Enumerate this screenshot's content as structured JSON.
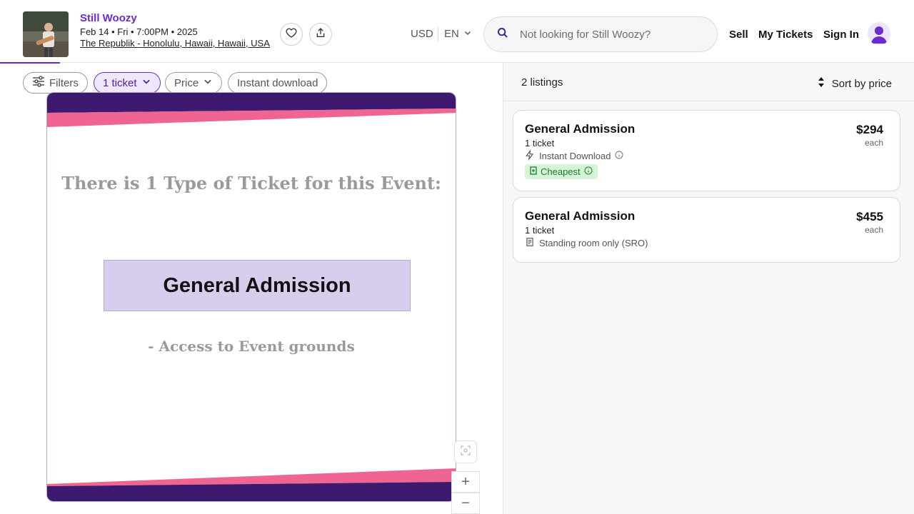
{
  "event": {
    "name": "Still Woozy",
    "date_line": "Feb 14 • Fri • 7:00PM • 2025",
    "venue": "The Republik - Honolulu, Hawaii, Hawaii, USA",
    "thumbnail_icon": "artist-photo"
  },
  "header": {
    "currency": "USD",
    "language": "EN",
    "search_placeholder": "Not looking for Still Woozy?",
    "nav": {
      "sell": "Sell",
      "my_tickets": "My Tickets",
      "sign_in": "Sign In"
    },
    "accent_color": "#6a2bd0"
  },
  "filters": {
    "filters_label": "Filters",
    "quantity_label": "1 ticket",
    "price_label": "Price",
    "instant_label": "Instant download"
  },
  "map": {
    "heading": "There is 1 Type of Ticket for this Event:",
    "section_label": "General Admission",
    "section_note": "- Access to Event grounds",
    "band_colors": {
      "purple": "#3d1a70",
      "pink": "#ef6490"
    },
    "zoom_in": "+",
    "zoom_out": "−"
  },
  "listings": {
    "count_label": "2 listings",
    "sort_label": "Sort by price",
    "items": [
      {
        "title": "General Admission",
        "quantity": "1 ticket",
        "feature": "Instant Download",
        "feature_icon": "lightning-icon",
        "badge": "Cheapest",
        "price": "$294",
        "price_unit": "each"
      },
      {
        "title": "General Admission",
        "quantity": "1 ticket",
        "feature": "Standing room only (SRO)",
        "feature_icon": "document-icon",
        "price": "$455",
        "price_unit": "each"
      }
    ]
  }
}
